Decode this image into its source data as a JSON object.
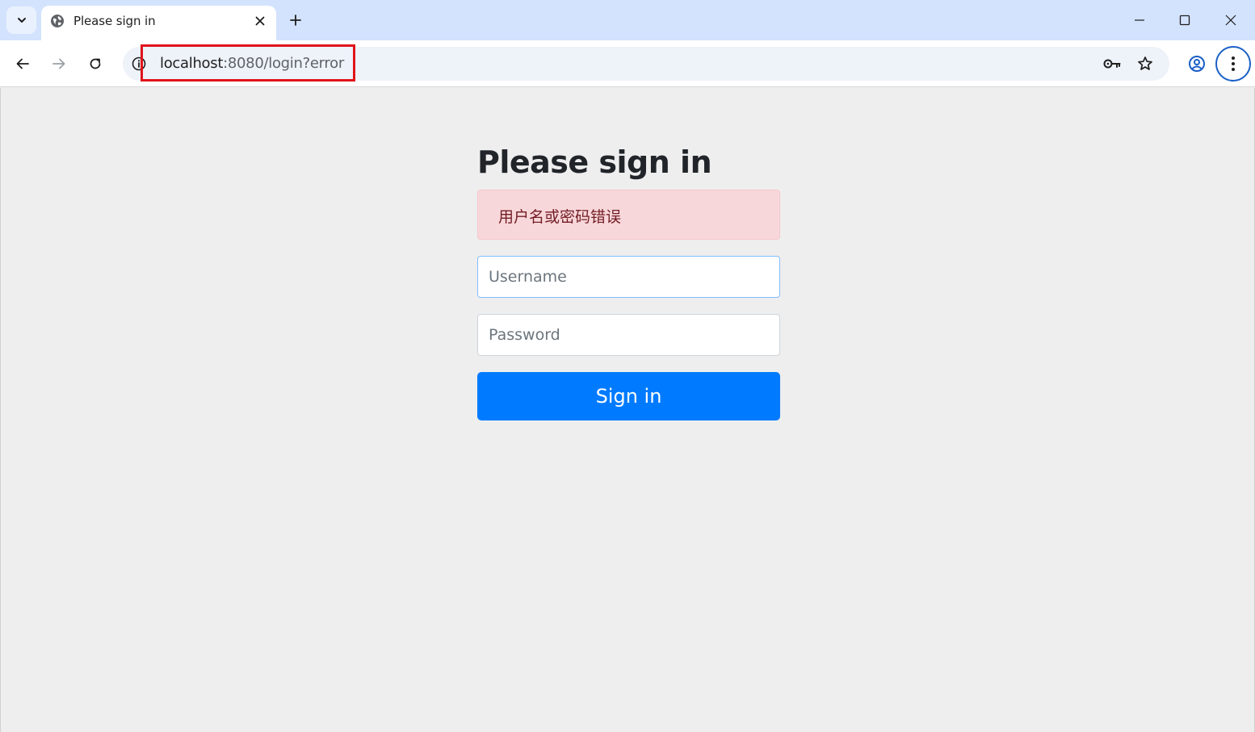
{
  "browser": {
    "tab": {
      "title": "Please sign in"
    },
    "address": {
      "host": "localhost",
      "rest": ":8080/login?error"
    }
  },
  "login": {
    "heading": "Please sign in",
    "error_message": "用户名或密码错误",
    "username": {
      "placeholder": "Username",
      "value": ""
    },
    "password": {
      "placeholder": "Password",
      "value": ""
    },
    "submit_label": "Sign in"
  },
  "colors": {
    "primary": "#007bff",
    "alert_bg": "#f8d7da",
    "alert_text": "#721c24",
    "highlight": "#e0141b"
  }
}
